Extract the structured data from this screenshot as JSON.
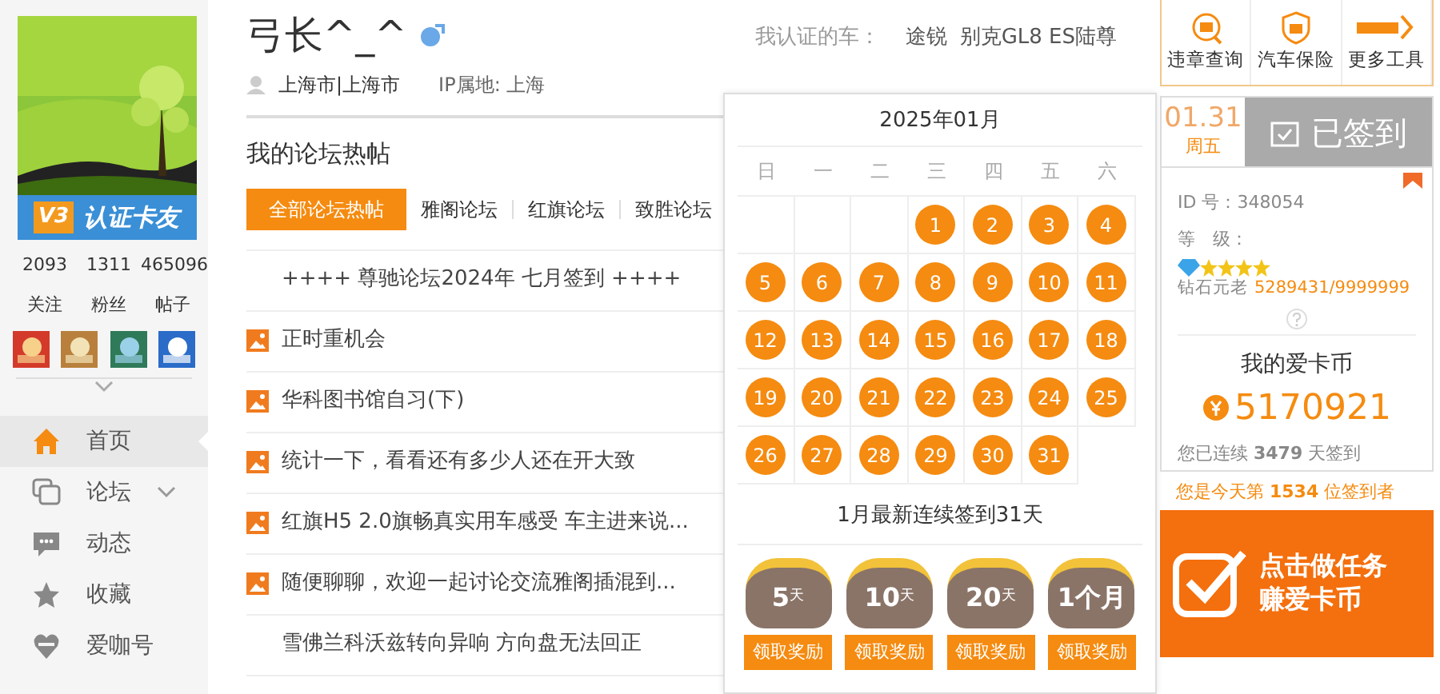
{
  "profile": {
    "badge_level": "V3",
    "badge_text": "认证卡友",
    "stats": [
      {
        "value": "2093",
        "label": "关注"
      },
      {
        "value": "1311",
        "label": "粉丝"
      },
      {
        "value": "465096",
        "label": "帖子"
      }
    ]
  },
  "nav": [
    {
      "label": "首页",
      "selected": true,
      "expandable": false
    },
    {
      "label": "论坛",
      "selected": false,
      "expandable": true
    },
    {
      "label": "动态",
      "selected": false,
      "expandable": false
    },
    {
      "label": "收藏",
      "selected": false,
      "expandable": false
    },
    {
      "label": "爱咖号",
      "selected": false,
      "expandable": false
    }
  ],
  "user": {
    "name": "弓长^_^",
    "location": "上海市|上海市",
    "ip": "IP属地: 上海",
    "cars_label": "我认证的车：",
    "cars": [
      "途锐",
      "别克GL8 ES陆尊"
    ]
  },
  "hot_posts": {
    "title": "我的论坛热帖",
    "tabs": [
      {
        "label": "全部论坛热帖",
        "selected": true
      },
      {
        "label": "雅阁论坛",
        "selected": false
      },
      {
        "label": "红旗论坛",
        "selected": false
      },
      {
        "label": "致胜论坛",
        "selected": false
      }
    ],
    "posts": [
      {
        "title": "++++ 尊驰论坛2024年 七月签到 ++++",
        "image": false
      },
      {
        "title": "正时重机会",
        "image": true
      },
      {
        "title": "华科图书馆自习(下)",
        "image": true
      },
      {
        "title": "统计一下，看看还有多少人还在开大致",
        "image": true
      },
      {
        "title": "红旗H5 2.0旗畅真实用车感受 车主进来说...",
        "image": true
      },
      {
        "title": "随便聊聊，欢迎一起讨论交流雅阁插混到...",
        "image": true
      },
      {
        "title": "雪佛兰科沃兹转向异响 方向盘无法回正",
        "image": false
      }
    ]
  },
  "calendar": {
    "month": "2025年01月",
    "weekdays": [
      "日",
      "一",
      "二",
      "三",
      "四",
      "五",
      "六"
    ],
    "days": [
      {
        "kind": "blank"
      },
      {
        "kind": "blank"
      },
      {
        "kind": "blank"
      },
      {
        "day": "1",
        "signed": true
      },
      {
        "day": "2",
        "signed": true
      },
      {
        "day": "3",
        "signed": true
      },
      {
        "day": "4",
        "signed": true
      },
      {
        "day": "5",
        "signed": true
      },
      {
        "day": "6",
        "signed": true
      },
      {
        "day": "7",
        "signed": true
      },
      {
        "day": "8",
        "signed": true
      },
      {
        "day": "9",
        "signed": true
      },
      {
        "day": "10",
        "signed": true
      },
      {
        "day": "11",
        "signed": true
      },
      {
        "day": "12",
        "signed": true
      },
      {
        "day": "13",
        "signed": true
      },
      {
        "day": "14",
        "signed": true
      },
      {
        "day": "15",
        "signed": true
      },
      {
        "day": "16",
        "signed": true
      },
      {
        "day": "17",
        "signed": true
      },
      {
        "day": "18",
        "signed": true
      },
      {
        "day": "19",
        "signed": true
      },
      {
        "day": "20",
        "signed": true
      },
      {
        "day": "21",
        "signed": true
      },
      {
        "day": "22",
        "signed": true
      },
      {
        "day": "23",
        "signed": true
      },
      {
        "day": "24",
        "signed": true
      },
      {
        "day": "25",
        "signed": true
      },
      {
        "day": "26",
        "signed": true
      },
      {
        "day": "27",
        "signed": true
      },
      {
        "day": "28",
        "signed": true
      },
      {
        "day": "29",
        "signed": true
      },
      {
        "day": "30",
        "signed": true
      },
      {
        "day": "31",
        "signed": true
      }
    ],
    "streak": "1月最新连续签到31天",
    "rewards": [
      {
        "amount": "5",
        "unit": "天",
        "button": "领取奖励"
      },
      {
        "amount": "10",
        "unit": "天",
        "button": "领取奖励"
      },
      {
        "amount": "20",
        "unit": "天",
        "button": "领取奖励"
      },
      {
        "amount": "1个月",
        "button": "领取奖励"
      }
    ]
  },
  "tools": [
    {
      "label": "违章查询"
    },
    {
      "label": "汽车保险"
    },
    {
      "label": "更多工具"
    }
  ],
  "signin": {
    "date": "01.31",
    "weekday": "周五",
    "status": "已签到",
    "signed": true
  },
  "account": {
    "id": "ID 号：348054",
    "level_label": "等　级：",
    "stars": 4,
    "rank": "钻石元老",
    "points": "5289431/9999999",
    "coins_title": "我的爱卡币",
    "coins": "5170921",
    "streak": "您已连续 **3479** 天签到",
    "rank_today": "您是今天第 **1534** 位签到者"
  },
  "task_banner": {
    "line1": "点击做任务",
    "line2": "赚爱卡币"
  }
}
